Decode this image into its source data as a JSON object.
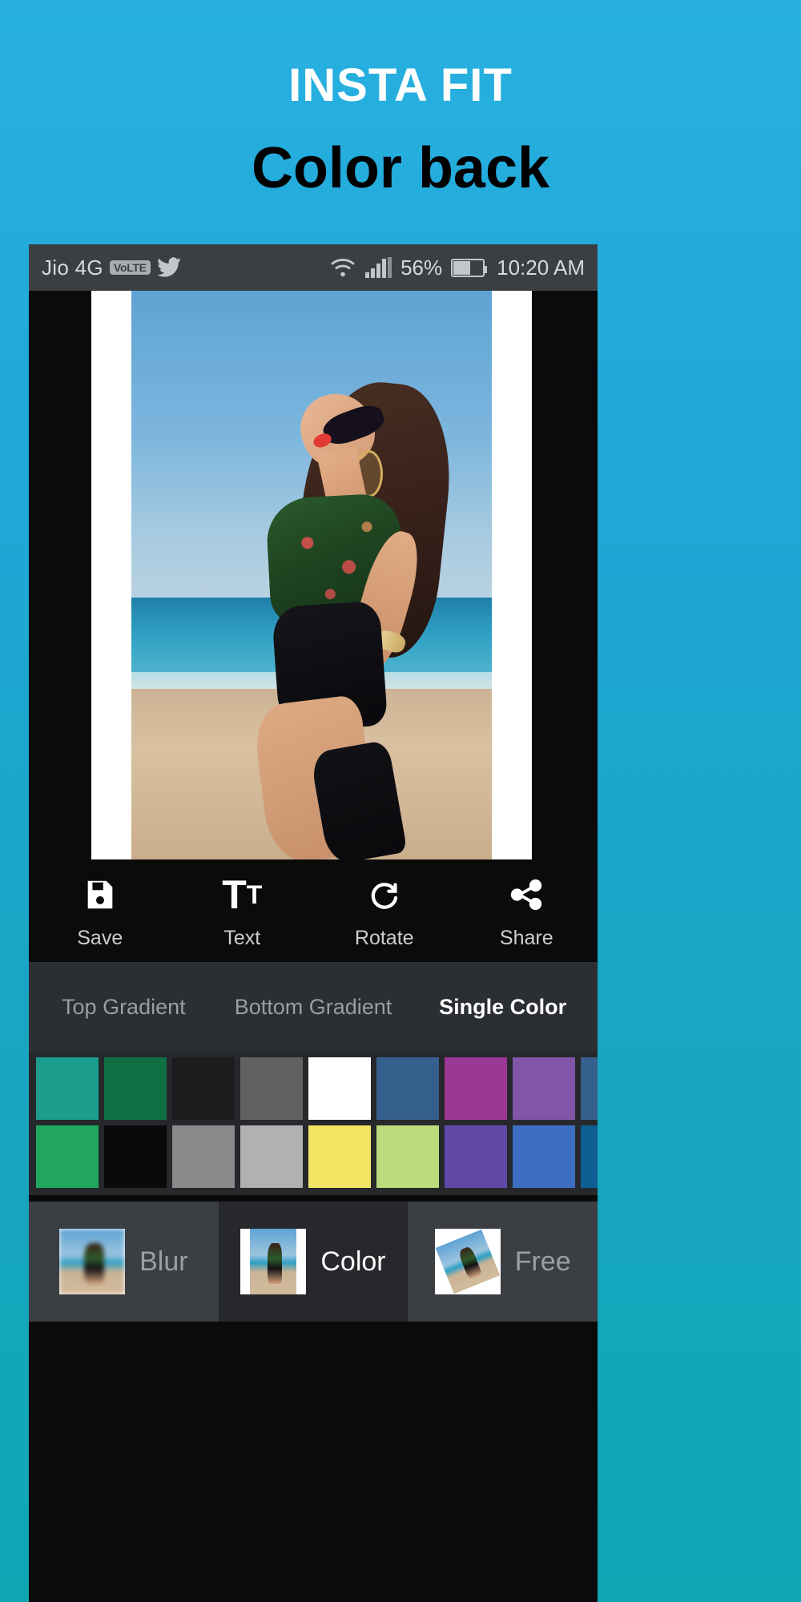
{
  "promo": {
    "title": "INSTA FIT",
    "subtitle": "Color back",
    "bg_top": "#27b0e0",
    "bg_bottom": "#10a6b4"
  },
  "status_bar": {
    "carrier": "Jio 4G",
    "volte_badge": "VoLTE",
    "twitter_icon": "twitter-bird-icon",
    "wifi_icon": "wifi-icon",
    "signal_icon": "signal-bars-icon",
    "battery_percent": "56%",
    "battery_icon": "battery-icon",
    "clock": "10:20 AM",
    "background": "#3b3f44",
    "foreground": "#d7d9dc"
  },
  "editor": {
    "canvas_background": "#0b0b0b",
    "frame_color": "#ffffff",
    "photo_alt": "woman-on-beach-photo"
  },
  "toolbar": {
    "items": [
      {
        "label": "Save",
        "icon": "save-icon"
      },
      {
        "label": "Text",
        "icon": "text-icon"
      },
      {
        "label": "Rotate",
        "icon": "rotate-icon"
      },
      {
        "label": "Share",
        "icon": "share-icon"
      }
    ]
  },
  "mode_tabs": {
    "items": [
      {
        "label": "Top Gradient",
        "active": false
      },
      {
        "label": "Bottom Gradient",
        "active": false
      },
      {
        "label": "Single Color",
        "active": true
      }
    ]
  },
  "swatches": {
    "row1": [
      "#1b9e8d",
      "#0f7044",
      "#1c1c1e",
      "#616161",
      "#ffffff",
      "#355f8c",
      "#9b3795",
      "#8155a8",
      "#355f8c"
    ],
    "row2": [
      "#21a85e",
      "#0a0a0a",
      "#8a8a8a",
      "#b0b2b2",
      "#f4e464",
      "#bcdb7a",
      "#6149a8",
      "#3d6ec4",
      "#0e5f93"
    ]
  },
  "bottom_modes": {
    "items": [
      {
        "label": "Blur",
        "thumb": "blur-thumbnail",
        "selected": false,
        "highlight": true
      },
      {
        "label": "Color",
        "thumb": "color-thumbnail",
        "selected": true,
        "highlight": false
      },
      {
        "label": "Free",
        "thumb": "free-thumbnail",
        "selected": false,
        "highlight": true
      }
    ]
  }
}
